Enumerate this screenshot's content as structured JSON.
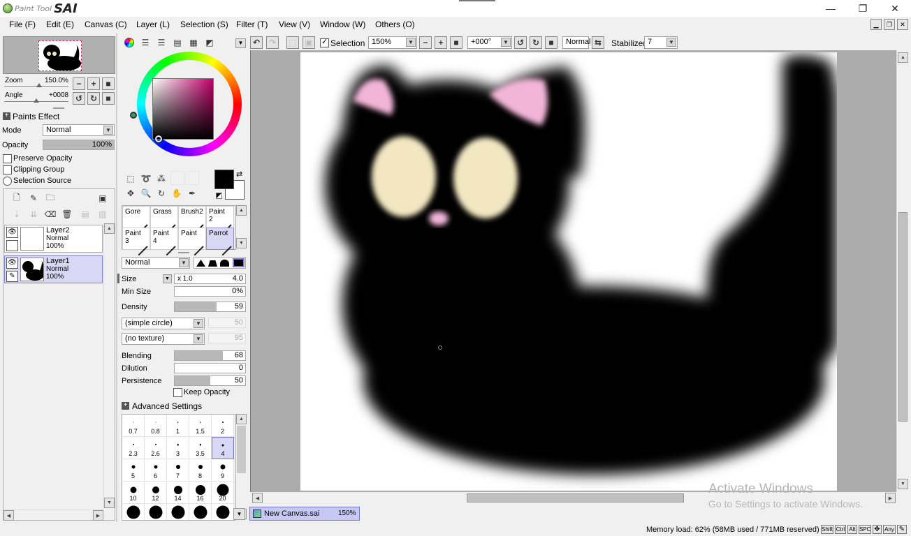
{
  "app": {
    "logo_small": "Paint Tool",
    "logo_big": "SAI"
  },
  "window_buttons": {
    "minimize": "—",
    "restore": "❐",
    "close": "✕"
  },
  "menu": [
    "File (F)",
    "Edit (E)",
    "Canvas (C)",
    "Layer (L)",
    "Selection (S)",
    "Filter (T)",
    "View (V)",
    "Window (W)",
    "Others (O)"
  ],
  "navigator": {
    "zoom_label": "Zoom",
    "zoom_value": "150.0%",
    "angle_label": "Angle",
    "angle_value": "+0008"
  },
  "paints_effect": {
    "header": "Paints Effect",
    "mode_label": "Mode",
    "mode_value": "Normal",
    "opacity_label": "Opacity",
    "opacity_value": "100%",
    "opacity_level": 1.0,
    "preserve_opacity": "Preserve Opacity",
    "clipping_group": "Clipping Group",
    "selection_source": "Selection Source"
  },
  "layers": [
    {
      "name": "Layer2",
      "mode": "Normal",
      "opacity": "100%",
      "selected": false
    },
    {
      "name": "Layer1",
      "mode": "Normal",
      "opacity": "100%",
      "selected": true
    }
  ],
  "brushes": [
    {
      "name": "Gore",
      "selected": false
    },
    {
      "name": "Grass",
      "selected": false
    },
    {
      "name": "Brush2",
      "selected": false
    },
    {
      "name": "Paint\n2",
      "selected": false
    },
    {
      "name": "Paint\n3",
      "selected": false
    },
    {
      "name": "Paint\n4",
      "selected": false
    },
    {
      "name": "Paint",
      "selected": false
    },
    {
      "name": "Parrot",
      "selected": true
    }
  ],
  "brush_settings": {
    "blend_mode": "Normal",
    "size_label": "Size",
    "size_mult": "x 1.0",
    "size_value": "4.0",
    "minsize_label": "Min Size",
    "minsize_value": "0%",
    "minsize_level": 0.0,
    "density_label": "Density",
    "density_value": "59",
    "density_level": 0.59,
    "shape": "(simple circle)",
    "shape_value": "50",
    "texture": "(no texture)",
    "texture_value": "95",
    "blending_label": "Blending",
    "blending_value": "68",
    "blending_level": 0.68,
    "dilution_label": "Dilution",
    "dilution_value": "0",
    "dilution_level": 0.0,
    "persistence_label": "Persistence",
    "persistence_value": "50",
    "persistence_level": 0.5,
    "keep_opacity": "Keep Opacity",
    "advanced": "Advanced Settings"
  },
  "brush_sizes": [
    "0.7",
    "0.8",
    "1",
    "1.5",
    "2",
    "2.3",
    "2.6",
    "3",
    "3.5",
    "4",
    "5",
    "6",
    "7",
    "8",
    "9",
    "10",
    "12",
    "14",
    "16",
    "20"
  ],
  "selected_size": "4",
  "canvas_toolbar": {
    "selection_label": "Selection",
    "zoom": "150%",
    "angle": "+000°",
    "blend": "Normal",
    "stabilizer_label": "Stabilizer",
    "stabilizer_value": "7"
  },
  "doc_tab": {
    "name": "New Canvas.sai",
    "zoom": "150%"
  },
  "watermark": {
    "line1": "Activate Windows",
    "line2": "Go to Settings to activate Windows."
  },
  "status": {
    "memory": "Memory load: 62% (58MB used / 771MB reserved)",
    "keys": [
      "Shift",
      "Ctrl",
      "Alt",
      "SPC",
      "Any"
    ]
  },
  "colors": {
    "selection_bg": "#d8d8f4",
    "primary_color": "#000000",
    "cat_ears": "#f2b5d8",
    "cat_eyes": "#f3e7c2"
  }
}
